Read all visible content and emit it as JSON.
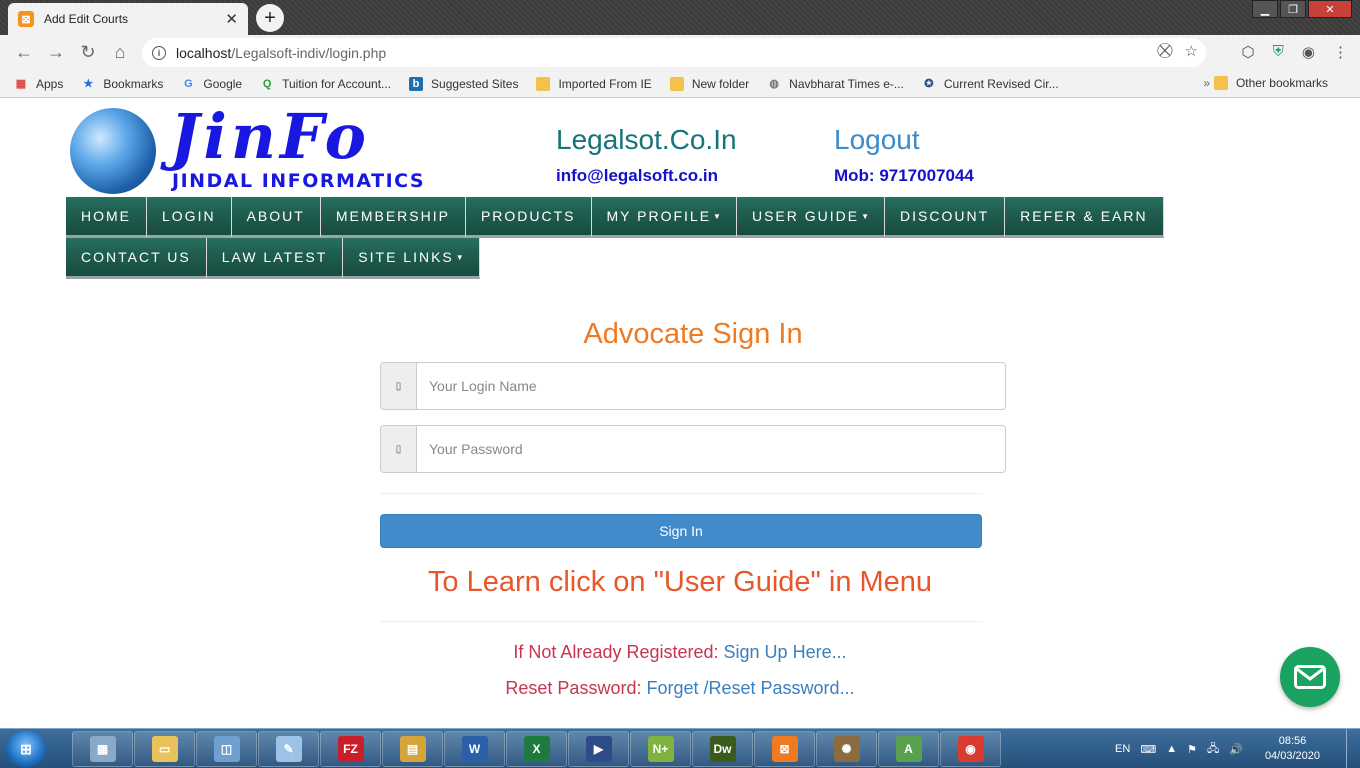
{
  "browser": {
    "tab_title": "Add Edit Courts",
    "tab_close": "✕",
    "new_tab": "+",
    "url_host": "localhost",
    "url_path": "/Legalsoft-indiv/login.php"
  },
  "bookmarks": {
    "items": [
      {
        "label": "Apps",
        "icon": "apps-grid-icon"
      },
      {
        "label": "Bookmarks",
        "icon": "star-icon"
      },
      {
        "label": "Google",
        "icon": "google-icon"
      },
      {
        "label": "Tuition for Account...",
        "icon": "q-icon"
      },
      {
        "label": "Suggested Sites",
        "icon": "bing-icon"
      },
      {
        "label": "Imported From IE",
        "icon": "folder-icon"
      },
      {
        "label": "New folder",
        "icon": "folder-icon"
      },
      {
        "label": "Navbharat Times e-...",
        "icon": "globe-icon"
      },
      {
        "label": "Current Revised Cir...",
        "icon": "site-icon"
      }
    ],
    "more": "»",
    "other": "Other bookmarks"
  },
  "header": {
    "logo_text": "JinFo",
    "logo_subtitle": "JINDAL INFORMATICS",
    "site_name": "Legalsot.Co.In",
    "logout": "Logout",
    "email": "info@legalsoft.co.in",
    "mobile": "Mob: 9717007044"
  },
  "menu": {
    "row1": [
      {
        "label": "HOME",
        "dropdown": false
      },
      {
        "label": "LOGIN",
        "dropdown": false
      },
      {
        "label": "ABOUT",
        "dropdown": false
      },
      {
        "label": "MEMBERSHIP",
        "dropdown": false
      },
      {
        "label": "PRODUCTS",
        "dropdown": false
      },
      {
        "label": "MY PROFILE",
        "dropdown": true
      },
      {
        "label": "USER GUIDE",
        "dropdown": true
      },
      {
        "label": "DISCOUNT",
        "dropdown": false
      },
      {
        "label": "REFER & EARN",
        "dropdown": false
      }
    ],
    "row2": [
      {
        "label": "CONTACT US",
        "dropdown": false
      },
      {
        "label": "LAW LATEST",
        "dropdown": false
      },
      {
        "label": "SITE LINKS",
        "dropdown": true
      }
    ]
  },
  "signin": {
    "title": "Advocate Sign In",
    "login_placeholder": "Your Login Name",
    "password_placeholder": "Your Password",
    "button": "Sign In",
    "learn": "To Learn click on \"User Guide\" in Menu",
    "register_label": "If Not Already Registered:",
    "register_link": "Sign Up Here...",
    "reset_label": "Reset Password:",
    "reset_link": "Forget /Reset Password..."
  },
  "taskbar": {
    "lang": "EN",
    "time": "08:56",
    "date": "04/03/2020",
    "apps": [
      {
        "icon": "calculator-icon",
        "color": "#8aa9c9",
        "glyph": "▦"
      },
      {
        "icon": "explorer-icon",
        "color": "#e8c25a",
        "glyph": "▭"
      },
      {
        "icon": "control-panel-icon",
        "color": "#6f9fce",
        "glyph": "◫"
      },
      {
        "icon": "notepad-icon",
        "color": "#9cc3e6",
        "glyph": "✎"
      },
      {
        "icon": "filezilla-icon",
        "color": "#c8202a",
        "glyph": "FZ"
      },
      {
        "icon": "presentation-icon",
        "color": "#d4a63a",
        "glyph": "▤"
      },
      {
        "icon": "word-icon",
        "color": "#2b5faa",
        "glyph": "W"
      },
      {
        "icon": "excel-icon",
        "color": "#1f7a3f",
        "glyph": "X"
      },
      {
        "icon": "media-player-icon",
        "color": "#2e4b8a",
        "glyph": "▶"
      },
      {
        "icon": "notepad-plus-icon",
        "color": "#7fb23f",
        "glyph": "N+"
      },
      {
        "icon": "dreamweaver-icon",
        "color": "#3a5a1e",
        "glyph": "Dw"
      },
      {
        "icon": "xampp-icon",
        "color": "#f07a21",
        "glyph": "⊠"
      },
      {
        "icon": "paint-icon",
        "color": "#8c6b3f",
        "glyph": "✺"
      },
      {
        "icon": "android-studio-icon",
        "color": "#5aa14f",
        "glyph": "A"
      },
      {
        "icon": "chrome-icon",
        "color": "#d93b30",
        "glyph": "◉"
      }
    ]
  }
}
